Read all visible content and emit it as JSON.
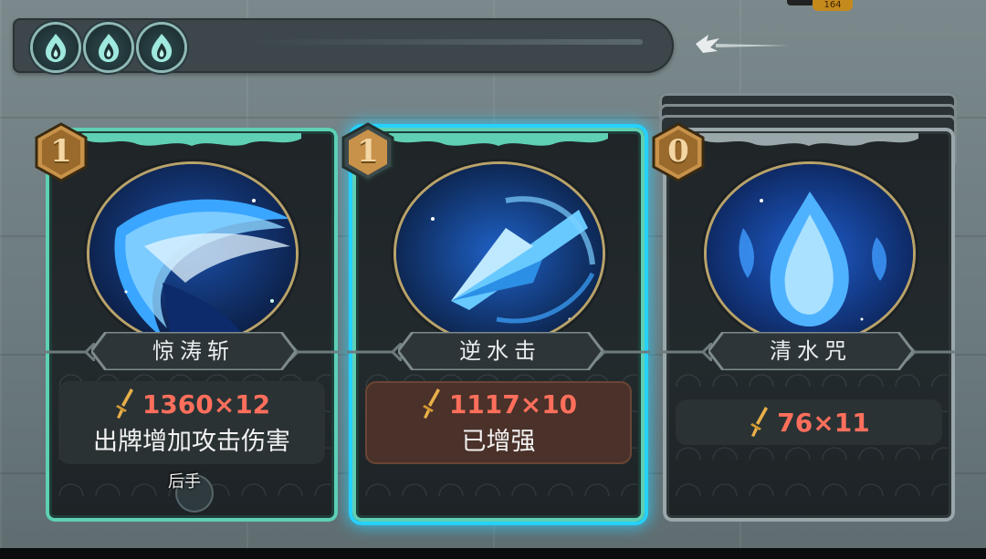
{
  "hud": {
    "energy_orbs": [
      "flame-icon",
      "flame-icon",
      "flame-icon"
    ],
    "back_icon": "back-arrow-icon",
    "top_right_value": "164"
  },
  "cards": [
    {
      "cost": "1",
      "name": "惊涛斩",
      "damage": "1360×12",
      "effect": "出牌增加攻击伤害",
      "tag": "后手",
      "frame": "teal",
      "art": "wave-slash",
      "selected": false
    },
    {
      "cost": "1",
      "name": "逆水击",
      "damage": "1117×10",
      "effect": "已增强",
      "frame": "teal",
      "art": "water-spear",
      "selected": true
    },
    {
      "cost": "0",
      "name": "清水咒",
      "damage": "76×11",
      "frame": "silver",
      "art": "water-drop",
      "selected": false
    }
  ],
  "colors": {
    "damage_text": "#ff6f5c",
    "selected_glow": "#25d1ff",
    "teal_frame": "#5fd0b4",
    "cost_gold": "#c8924a"
  }
}
